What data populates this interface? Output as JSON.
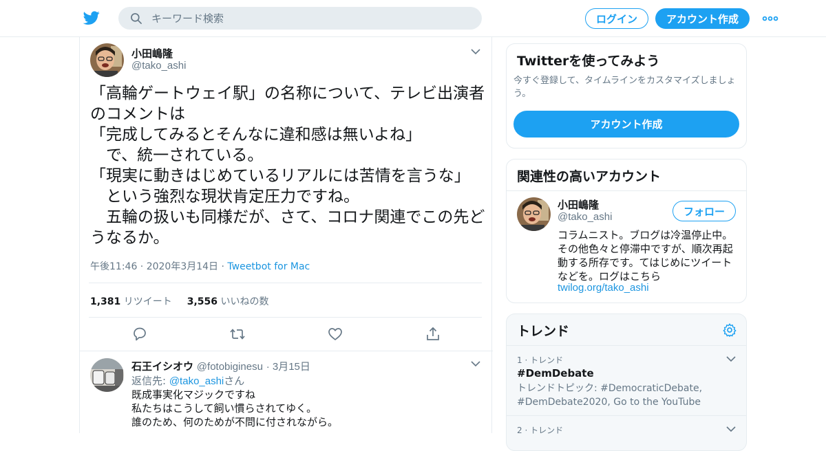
{
  "header": {
    "search_placeholder": "キーワード検索",
    "login_label": "ログイン",
    "signup_label": "アカウント作成"
  },
  "tweet": {
    "author_name": "小田嶋隆",
    "author_handle": "@tako_ashi",
    "text": "「高輪ゲートウェイ駅」の名称について、テレビ出演者のコメントは\n「完成してみるとそんなに違和感は無いよね」\n　で、統一されている。\n「現実に動きはじめているリアルには苦情を言うな」\n　という強烈な現状肯定圧力ですね。\n　五輪の扱いも同様だが、さて、コロナ関連でこの先どうなるか。",
    "timestamp": "午後11:46 · 2020年3月14日",
    "separator": " · ",
    "client": "Tweetbot for Mac",
    "retweet_count": "1,381",
    "retweet_label": "リツイート",
    "like_count": "3,556",
    "like_label": "いいねの数"
  },
  "reply": {
    "author_name": "石王イシオウ",
    "author_handle": "@fotobiginesu",
    "date": "· 3月15日",
    "reply_to_prefix": "返信先: ",
    "reply_to_handle": "@tako_ashi",
    "reply_to_suffix": "さん",
    "text": "既成事実化マジックですね\n私たちはこうして飼い慣らされてゆく。\n誰のため、何のためが不問に付されながら。"
  },
  "signup_card": {
    "title": "Twitterを使ってみよう",
    "subtitle": "今すぐ登録して、タイムラインをカスタマイズしましょう。",
    "button_label": "アカウント作成"
  },
  "related_card": {
    "title": "関連性の高いアカウント",
    "name": "小田嶋隆",
    "handle": "@tako_ashi",
    "follow_label": "フォロー",
    "bio": "コラムニスト。ブログは冷温停止中。その他色々と停滞中ですが、順次再起動する所存です。てはじめにツイートなどを。ログはこちら",
    "bio_link": "twilog.org/tako_ashi"
  },
  "trends_card": {
    "title": "トレンド",
    "items": [
      {
        "rank": "1 · トレンド",
        "name": "#DemDebate",
        "desc": "トレンドトピック: #DemocraticDebate, #DemDebate2020, Go to the YouTube"
      },
      {
        "rank": "2 · トレンド",
        "name": "",
        "desc": ""
      }
    ]
  },
  "colors": {
    "accent": "#1da1f2",
    "link": "#1b95e0",
    "muted": "#657786",
    "border": "#e6ecf0"
  },
  "icons": [
    "twitter-bird-icon",
    "search-icon",
    "more-dots-icon",
    "chevron-down-icon",
    "reply-icon",
    "retweet-icon",
    "like-icon",
    "share-icon",
    "gear-icon"
  ]
}
